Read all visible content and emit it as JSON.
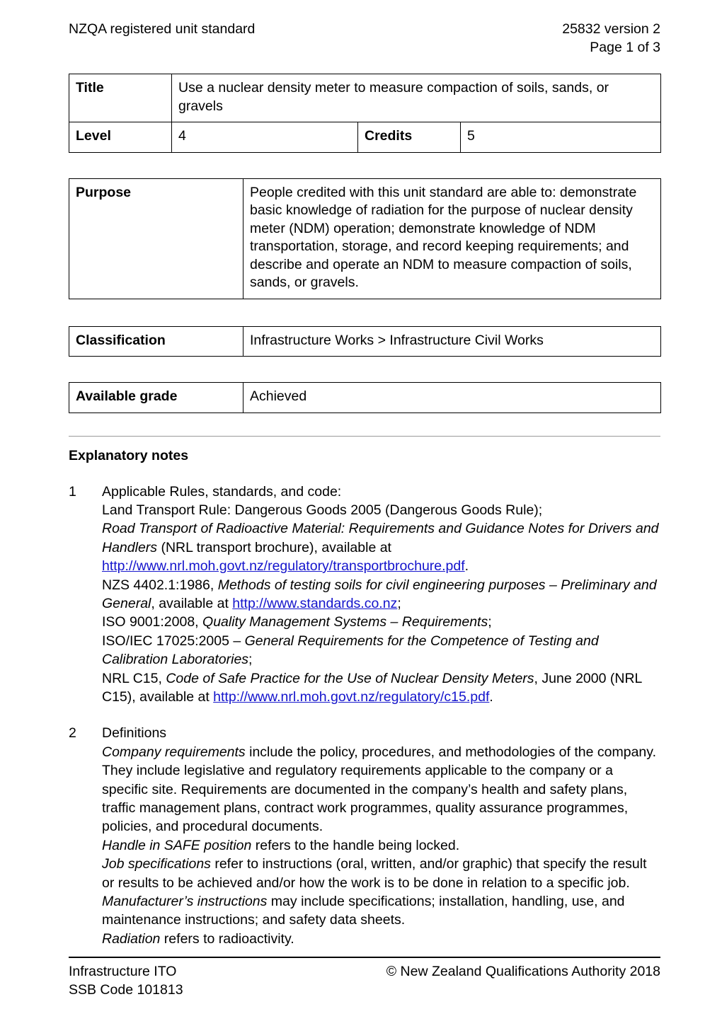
{
  "header": {
    "left": "NZQA registered unit standard",
    "right_line1": "25832 version 2",
    "right_line2": "Page 1 of 3"
  },
  "title_table": {
    "title_label": "Title",
    "title_value": "Use a nuclear density meter to measure compaction of soils, sands, or gravels",
    "level_label": "Level",
    "level_value": "4",
    "credits_label": "Credits",
    "credits_value": "5"
  },
  "purpose_table": {
    "label": "Purpose",
    "value": "People credited with this unit standard are able to: demonstrate basic knowledge of radiation for the purpose of nuclear density meter (NDM) operation; demonstrate knowledge of NDM transportation, storage, and record keeping requirements; and describe and operate an NDM to measure compaction of soils, sands, or gravels."
  },
  "classification_table": {
    "label": "Classification",
    "value": "Infrastructure Works > Infrastructure Civil Works"
  },
  "grade_table": {
    "label": "Available grade",
    "value": "Achieved"
  },
  "explanatory_notes": {
    "heading": "Explanatory notes",
    "note1": {
      "number": "1",
      "line_intro": "Applicable Rules, standards, and code:",
      "line_land_transport": "Land Transport Rule: Dangerous Goods 2005 (Dangerous Goods Rule);",
      "road_transport_italic": "Road Transport of Radioactive Material: Requirements and Guidance Notes for Drivers and Handlers",
      "road_transport_tail": " (NRL transport brochure), available at ",
      "link_transport_brochure": "http://www.nrl.moh.govt.nz/regulatory/transportbrochure.pdf",
      "nzs_prefix": "NZS 4402.1:1986, ",
      "nzs_italic": "Methods of testing soils for civil engineering purposes – Preliminary and General",
      "nzs_mid": ", available at ",
      "link_standards": "http://www.standards.co.nz",
      "iso9001_prefix": "ISO 9001:2008, ",
      "iso9001_italic": "Quality Management Systems – Requirements",
      "iso17025_prefix": "ISO/IEC 17025:2005 – ",
      "iso17025_italic": "General Requirements for the Competence of Testing and Calibration Laboratories",
      "nrl_prefix": "NRL C15, ",
      "nrl_italic": "Code of Safe Practice for the Use of Nuclear Density Meters",
      "nrl_mid": ", June 2000 (NRL C15), available at ",
      "link_c15": "http://www.nrl.moh.govt.nz/regulatory/c15.pdf"
    },
    "note2": {
      "number": "2",
      "heading": "Definitions",
      "company_italic": "Company requirements",
      "company_text": " include the policy, procedures, and methodologies of the company.  They include legislative and regulatory requirements applicable to the company or a specific site.  Requirements are documented in the company’s health and safety plans, traffic management plans, contract work programmes, quality assurance programmes, policies, and procedural documents.",
      "handle_italic": "Handle in SAFE position",
      "handle_text": " refers to the handle being locked.",
      "job_italic": "Job specifications",
      "job_text": " refer to instructions (oral, written, and/or graphic) that specify the result or results to be achieved and/or how the work is to be done in relation to a specific job.",
      "manufacturer_italic": "Manufacturer’s instructions",
      "manufacturer_text": " may include specifications; installation, handling, use, and maintenance instructions; and safety data sheets.",
      "radiation_italic": "Radiation",
      "radiation_text": " refers to radioactivity."
    }
  },
  "footer": {
    "left": "Infrastructure ITO\nSSB Code 101813",
    "right": "© New Zealand Qualifications Authority 2018"
  },
  "colors": {
    "link": "#1414cc",
    "label_bg": "#f2f2f2",
    "border": "#000000"
  }
}
